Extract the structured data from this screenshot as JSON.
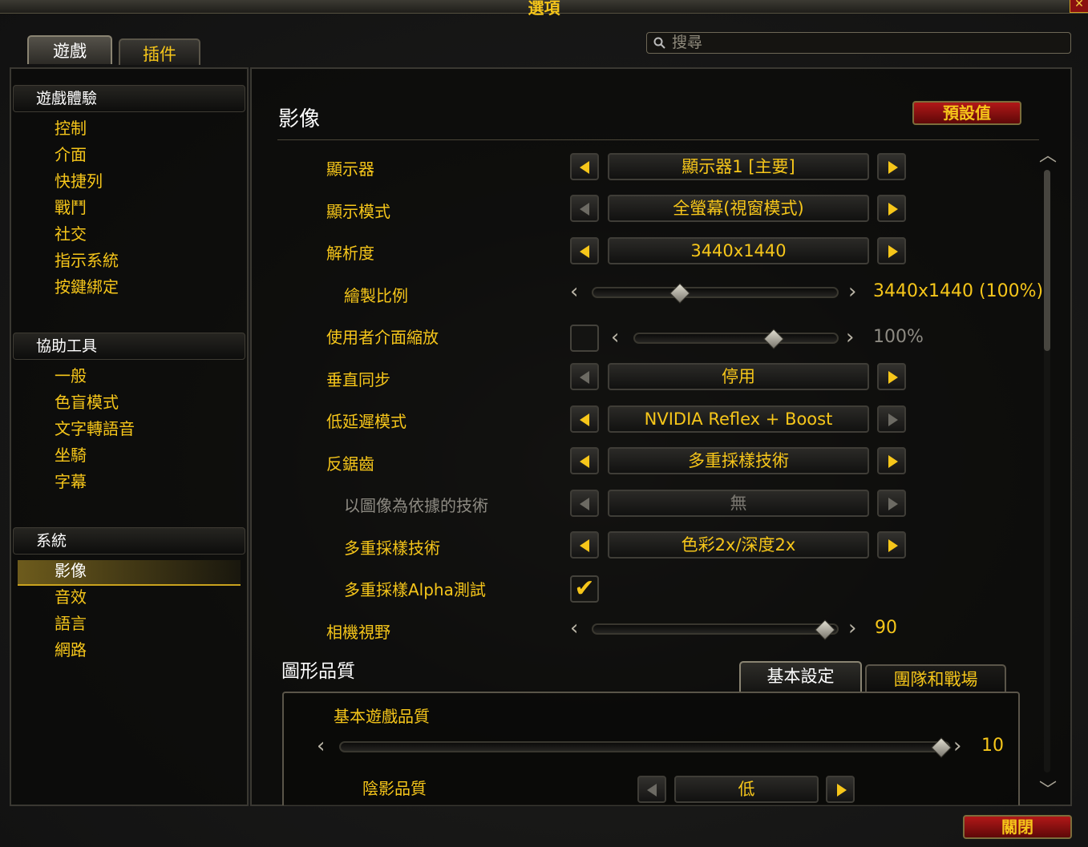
{
  "window": {
    "title": "選項",
    "close_label": "✕"
  },
  "tabs": [
    {
      "label": "遊戲",
      "active": true
    },
    {
      "label": "插件",
      "active": false
    }
  ],
  "search": {
    "placeholder": "搜尋"
  },
  "sidebar": {
    "categories": [
      {
        "label": "遊戲體驗",
        "items": [
          "控制",
          "介面",
          "快捷列",
          "戰鬥",
          "社交",
          "指示系統",
          "按鍵綁定"
        ]
      },
      {
        "label": "協助工具",
        "items": [
          "一般",
          "色盲模式",
          "文字轉語音",
          "坐騎",
          "字幕"
        ]
      },
      {
        "label": "系統",
        "items": [
          "影像",
          "音效",
          "語言",
          "網路"
        ]
      }
    ],
    "selected": "影像"
  },
  "main": {
    "title": "影像",
    "defaults_button": "預設值",
    "options": [
      {
        "label": "顯示器",
        "type": "select",
        "value": "顯示器1 [主要]",
        "left_enabled": true,
        "right_enabled": true
      },
      {
        "label": "顯示模式",
        "type": "select",
        "value": "全螢幕(視窗模式)",
        "left_enabled": false,
        "right_enabled": true
      },
      {
        "label": "解析度",
        "type": "select",
        "value": "3440x1440",
        "left_enabled": true,
        "right_enabled": true
      },
      {
        "label": "繪製比例",
        "type": "slider",
        "value_text": "3440x1440 (100%)",
        "level": 0.34,
        "indent": true
      },
      {
        "label": "使用者介面縮放",
        "type": "checkbox-slider",
        "checked": false,
        "value_text": "100%",
        "level": 0.7,
        "enabled": false
      },
      {
        "label": "垂直同步",
        "type": "select",
        "value": "停用",
        "left_enabled": false,
        "right_enabled": true
      },
      {
        "label": "低延遲模式",
        "type": "select",
        "value": "NVIDIA Reflex + Boost",
        "left_enabled": true,
        "right_enabled": false
      },
      {
        "label": "反鋸齒",
        "type": "select",
        "value": "多重採樣技術",
        "left_enabled": true,
        "right_enabled": true
      },
      {
        "label": "以圖像為依據的技術",
        "type": "select",
        "value": "無",
        "indent": true,
        "enabled": false
      },
      {
        "label": "多重採樣技術",
        "type": "select",
        "value": "色彩2x/深度2x",
        "indent": true,
        "left_enabled": true,
        "right_enabled": true
      },
      {
        "label": "多重採樣Alpha測試",
        "type": "checkbox",
        "checked": true,
        "indent": true
      },
      {
        "label": "相機視野",
        "type": "slider",
        "value_text": "90",
        "level": 0.98
      }
    ],
    "graphics": {
      "title": "圖形品質",
      "tabs": [
        {
          "label": "基本設定",
          "active": true
        },
        {
          "label": "團隊和戰場",
          "active": false
        }
      ],
      "base_quality": {
        "label": "基本遊戲品質",
        "value_text": "10",
        "level": 1.0
      },
      "shadow_quality": {
        "label": "陰影品質",
        "value": "低"
      }
    }
  },
  "footer": {
    "close_button": "關閉"
  },
  "colors": {
    "accent_gold": "#f6c61a",
    "button_red": "#b21818",
    "panel_bg": "#0a0a09"
  }
}
